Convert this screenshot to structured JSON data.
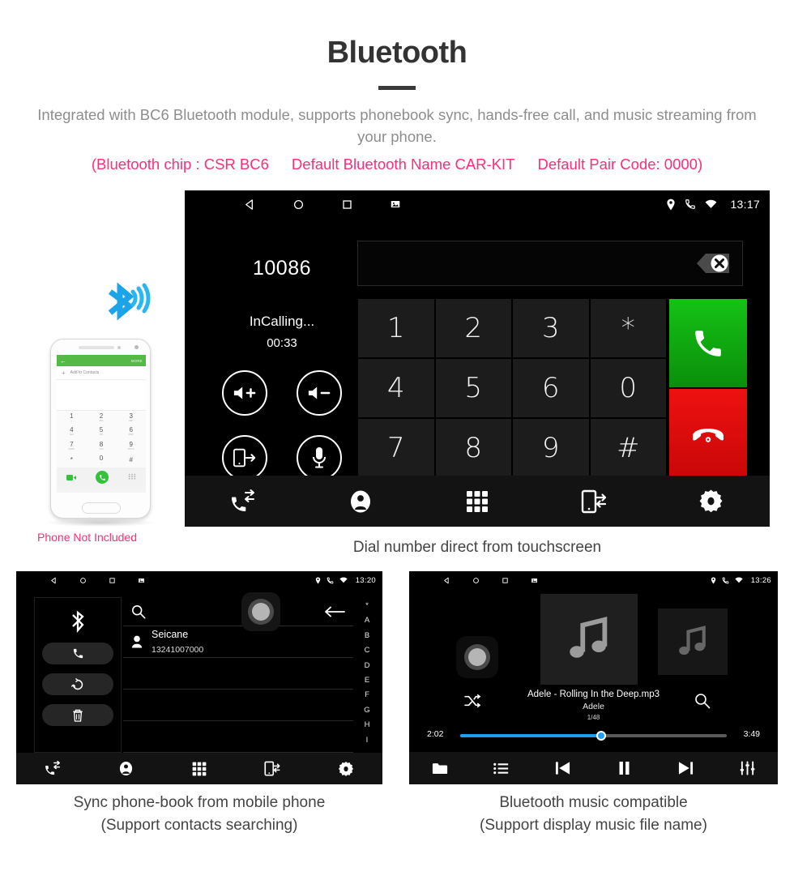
{
  "header": {
    "title": "Bluetooth",
    "subtitle": "Integrated with BC6 Bluetooth module, supports phonebook sync, hands-free call, and music streaming from your phone.",
    "spec_chip": "(Bluetooth chip : CSR BC6",
    "spec_name": "Default Bluetooth Name CAR-KIT",
    "spec_pair": "Default Pair Code: 0000)",
    "accent_pink": "#ff2d78",
    "subtitle_color": "#8d8d8d"
  },
  "phone_mock": {
    "caption": "Phone Not Included",
    "topbar_back": "←",
    "topbar_more": "MORE",
    "add_contacts": "Add to Contacts",
    "keys": [
      {
        "digit": "1",
        "sub": "∞"
      },
      {
        "digit": "2",
        "sub": "ABC"
      },
      {
        "digit": "3",
        "sub": "DEF"
      },
      {
        "digit": "4",
        "sub": "GHI"
      },
      {
        "digit": "5",
        "sub": "JKL"
      },
      {
        "digit": "6",
        "sub": "MNO"
      },
      {
        "digit": "7",
        "sub": "PQRS"
      },
      {
        "digit": "8",
        "sub": "TUV"
      },
      {
        "digit": "9",
        "sub": "WXYZ"
      },
      {
        "digit": "*",
        "sub": ""
      },
      {
        "digit": "0",
        "sub": "+"
      },
      {
        "digit": "#",
        "sub": ""
      }
    ],
    "bluetooth_icon": "bluetooth-signal-icon",
    "green_accent": "#55b947"
  },
  "dialer": {
    "caption": "Dial number direct from touchscreen",
    "statusbar": {
      "nav_icons": [
        "back-icon",
        "home-icon",
        "recents-icon",
        "screenshot-icon"
      ],
      "sys_icons": [
        "location-pin-icon",
        "phone-icon",
        "wifi-icon"
      ],
      "time": "13:17"
    },
    "number": "10086",
    "input_value": "",
    "backspace_icon": "backspace-delete-icon",
    "call_state": "InCalling...",
    "call_timer": "00:33",
    "controls": [
      {
        "name": "volume-up-button",
        "icon": "speaker-plus-icon"
      },
      {
        "name": "volume-down-button",
        "icon": "speaker-minus-icon"
      },
      {
        "name": "transfer-to-phone-button",
        "icon": "phone-transfer-icon"
      },
      {
        "name": "mute-microphone-button",
        "icon": "microphone-icon"
      }
    ],
    "keypad": [
      "1",
      "2",
      "3",
      "*",
      "4",
      "5",
      "6",
      "0",
      "7",
      "8",
      "9",
      "#"
    ],
    "call_button": {
      "name": "call-button",
      "icon": "handset-icon",
      "color": "#15c215"
    },
    "hangup_button": {
      "name": "hangup-button",
      "icon": "handset-down-icon",
      "color": "#ee1111"
    },
    "navbar": [
      {
        "name": "nav-call-log",
        "icon": "call-log-icon"
      },
      {
        "name": "nav-contacts",
        "icon": "contact-person-icon"
      },
      {
        "name": "nav-keypad",
        "icon": "keypad-grid-icon"
      },
      {
        "name": "nav-phone-sync",
        "icon": "phone-sync-icon"
      },
      {
        "name": "nav-settings",
        "icon": "gear-icon"
      }
    ]
  },
  "phonebook": {
    "caption_line1": "Sync phone-book from mobile phone",
    "caption_line2": "(Support contacts searching)",
    "statusbar": {
      "nav_icons": [
        "back-icon",
        "home-icon",
        "recents-icon",
        "screenshot-icon"
      ],
      "sys_icons": [
        "location-pin-icon",
        "phone-icon",
        "wifi-icon"
      ],
      "time": "13:20"
    },
    "side_icon": "bluetooth-icon",
    "side_buttons": [
      {
        "name": "phonebook-call-button",
        "icon": "handset-icon"
      },
      {
        "name": "phonebook-sync-button",
        "icon": "refresh-sync-icon"
      },
      {
        "name": "phonebook-delete-button",
        "icon": "trash-icon"
      }
    ],
    "search_icon": "search-icon",
    "search_value": "",
    "back_icon": "arrow-left-icon",
    "contacts": [
      {
        "name": "Seicane",
        "number": "13241007000"
      }
    ],
    "empty_rows": 3,
    "index_letters": [
      "*",
      "A",
      "B",
      "C",
      "D",
      "E",
      "F",
      "G",
      "H",
      "I"
    ],
    "navbar": [
      {
        "name": "nav-call-log",
        "icon": "call-log-icon"
      },
      {
        "name": "nav-contacts",
        "icon": "contact-person-icon"
      },
      {
        "name": "nav-keypad",
        "icon": "keypad-grid-icon"
      },
      {
        "name": "nav-phone-sync",
        "icon": "phone-sync-icon"
      },
      {
        "name": "nav-settings",
        "icon": "gear-icon"
      }
    ]
  },
  "music": {
    "caption_line1": "Bluetooth music compatible",
    "caption_line2": "(Support display music file name)",
    "statusbar": {
      "nav_icons": [
        "back-icon",
        "home-icon",
        "recents-icon",
        "screenshot-icon"
      ],
      "sys_icons": [
        "location-pin-icon",
        "phone-icon",
        "wifi-icon"
      ],
      "time": "13:26"
    },
    "track_title": "Adele - Rolling In the Deep.mp3",
    "artist": "Adele",
    "track_count": "1/48",
    "elapsed": "2:02",
    "total": "3:49",
    "progress_percent": 53,
    "progress_color": "#1c9ff0",
    "shuffle_icon": "shuffle-icon",
    "search_icon": "search-icon",
    "album_art_icon": "music-note-icon",
    "navbar": [
      {
        "name": "music-folder-button",
        "icon": "folder-icon"
      },
      {
        "name": "music-playlist-button",
        "icon": "list-icon"
      },
      {
        "name": "music-previous-button",
        "icon": "previous-track-icon"
      },
      {
        "name": "music-pause-button",
        "icon": "pause-icon"
      },
      {
        "name": "music-next-button",
        "icon": "next-track-icon"
      },
      {
        "name": "music-equalizer-button",
        "icon": "equalizer-icon"
      }
    ]
  }
}
